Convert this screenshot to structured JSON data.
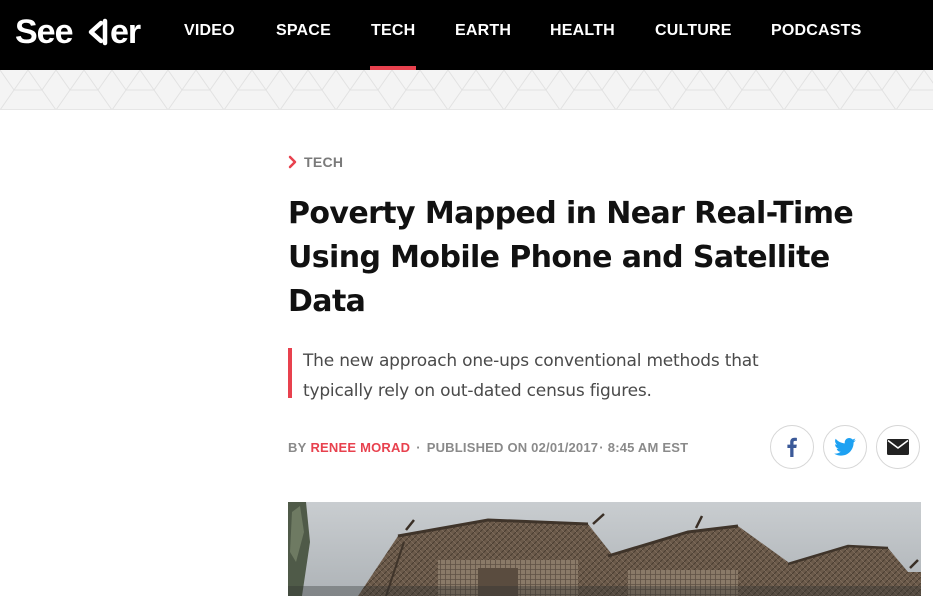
{
  "brand": {
    "name": "Seeker",
    "accent_color": "#e8414e",
    "logo_text_left": "See",
    "logo_text_right": "er"
  },
  "nav": {
    "items": [
      {
        "label": "VIDEO",
        "active": false
      },
      {
        "label": "SPACE",
        "active": false
      },
      {
        "label": "TECH",
        "active": true
      },
      {
        "label": "EARTH",
        "active": false
      },
      {
        "label": "HEALTH",
        "active": false
      },
      {
        "label": "CULTURE",
        "active": false
      },
      {
        "label": "PODCASTS",
        "active": false
      }
    ]
  },
  "article": {
    "category": "TECH",
    "category_icon": "chevron-right-icon",
    "headline_lines": [
      "Poverty Mapped in Near Real-Time",
      "Using Mobile Phone and Satellite",
      "Data"
    ],
    "dek_lines": [
      "The new approach one-ups conventional methods that",
      "typically rely on out-dated census figures."
    ],
    "byline": {
      "by": "BY",
      "author": "RENEE MORAD",
      "separator": "·",
      "published": "PUBLISHED ON 02/01/2017",
      "time_separator": "·",
      "time": "8:45 AM EST"
    },
    "share_buttons": [
      {
        "network": "facebook",
        "icon": "facebook-icon",
        "color": "#3b5998"
      },
      {
        "network": "twitter",
        "icon": "twitter-icon",
        "color": "#1da1f2"
      },
      {
        "network": "email",
        "icon": "email-icon",
        "color": "#222222"
      }
    ],
    "hero_image": {
      "subject": "thatched wooden stilt houses"
    }
  }
}
